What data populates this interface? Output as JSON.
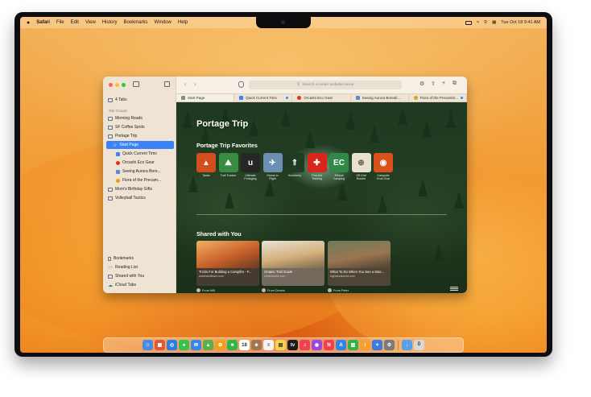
{
  "menubar": {
    "app": "Safari",
    "menus": [
      "File",
      "Edit",
      "View",
      "History",
      "Bookmarks",
      "Window",
      "Help"
    ],
    "clock": "Tue Oct 18  9:41 AM"
  },
  "sidebar": {
    "tabs_label": "4 Tabs",
    "tab_groups_header": "Tab Groups",
    "groups": [
      {
        "label": "Morning Reads"
      },
      {
        "label": "SF Coffee Spots"
      },
      {
        "label": "Portage Trip"
      }
    ],
    "portage_children": [
      {
        "label": "Start Page",
        "selected": true
      },
      {
        "label": "Quick Current Tims"
      },
      {
        "label": "Orcashi Eco Gear"
      },
      {
        "label": "Seeing Aurora Bore..."
      },
      {
        "label": "Flora of the Precam..."
      }
    ],
    "more_groups": [
      {
        "label": "Mom's Birthday Gifts"
      },
      {
        "label": "Volleyball Tactics"
      }
    ],
    "bottom": [
      {
        "label": "Bookmarks"
      },
      {
        "label": "Reading List"
      },
      {
        "label": "Shared with You"
      },
      {
        "label": "iCloud Tabs"
      }
    ]
  },
  "toolbar": {
    "search_placeholder": "Search or enter website name"
  },
  "tabs": [
    {
      "label": "Start Page",
      "color": "#8a8a8a"
    },
    {
      "label": "Quick Current Tims",
      "color": "#3b82f6"
    },
    {
      "label": "Orcashi Eco Gear",
      "color": "#d9381e"
    },
    {
      "label": "Seeing Aurora Boreali...",
      "color": "#5a8ad6"
    },
    {
      "label": "Flora of the Precambr...",
      "color": "#e0a020"
    }
  ],
  "page": {
    "title": "Portage Trip",
    "favorites_title": "Portage Trip Favorites",
    "favorites": [
      {
        "label": "Tanke",
        "glyph": "▲",
        "color": "#d24e1f"
      },
      {
        "label": "Trail Tracker",
        "glyph": "⛰",
        "color": "#3a8c45"
      },
      {
        "label": "Ultimate Portaging",
        "glyph": "u",
        "color": "#262626"
      },
      {
        "label": "Geese in Flight",
        "glyph": "✈",
        "color": "#6a8fb0"
      },
      {
        "label": "Huckberry",
        "glyph": "⇑",
        "color": "#1f3b22"
      },
      {
        "label": "First Aid Training",
        "glyph": "✚",
        "color": "#d9261c"
      },
      {
        "label": "Ethical Camping",
        "glyph": "EC",
        "color": "#2f8a4a"
      },
      {
        "label": "Off Grid Routes",
        "glyph": "⊕",
        "color": "#e8e1cf"
      },
      {
        "label": "Campsite Grub Club",
        "glyph": "◉",
        "color": "#d9521c"
      }
    ],
    "shared_title": "Shared with You",
    "shared": [
      {
        "title": "Tricks For Building a Campfire - F...",
        "source": "watchandlearn.com",
        "from": "From Will",
        "color": "#d8874a"
      },
      {
        "title": "Ontario Trail Guide",
        "source": "ontariotrails.com",
        "from": "From Dennis",
        "color": "#c9bfae"
      },
      {
        "title": "What To Do When You See a Moo...",
        "source": "sightandsound.com",
        "from": "From Peter",
        "color": "#9a7652"
      }
    ]
  },
  "dock": {
    "icons": [
      {
        "name": "finder-icon",
        "color": "#4a8be6",
        "glyph": "☺"
      },
      {
        "name": "launchpad-icon",
        "color": "#e05a3a",
        "glyph": "▦"
      },
      {
        "name": "safari-icon",
        "color": "#2e7de0",
        "glyph": "◎"
      },
      {
        "name": "messages-icon",
        "color": "#38c24a",
        "glyph": "●"
      },
      {
        "name": "mail-icon",
        "color": "#3a86e8",
        "glyph": "✉"
      },
      {
        "name": "maps-icon",
        "color": "#5ab04f",
        "glyph": "▲"
      },
      {
        "name": "photos-icon",
        "color": "#f0a020",
        "glyph": "✿"
      },
      {
        "name": "facetime-icon",
        "color": "#2fb84a",
        "glyph": "■"
      },
      {
        "name": "calendar-icon",
        "color": "#ffffff",
        "glyph": "18"
      },
      {
        "name": "contacts-icon",
        "color": "#a07850",
        "glyph": "☻"
      },
      {
        "name": "reminders-icon",
        "color": "#f4f4f4",
        "glyph": "≡"
      },
      {
        "name": "notes-icon",
        "color": "#f6d34a",
        "glyph": "▤"
      },
      {
        "name": "tv-icon",
        "color": "#1c1c1c",
        "glyph": "tv"
      },
      {
        "name": "music-icon",
        "color": "#f0424e",
        "glyph": "♫"
      },
      {
        "name": "podcasts-icon",
        "color": "#9a4ad8",
        "glyph": "◉"
      },
      {
        "name": "news-icon",
        "color": "#f0424e",
        "glyph": "N"
      },
      {
        "name": "appstore-icon",
        "color": "#2f86e6",
        "glyph": "A"
      },
      {
        "name": "numbers-icon",
        "color": "#30b24a",
        "glyph": "▥"
      },
      {
        "name": "pages-icon",
        "color": "#f3a030",
        "glyph": "/"
      },
      {
        "name": "xcode-icon",
        "color": "#3a7ae0",
        "glyph": "✧"
      },
      {
        "name": "settings-icon",
        "color": "#7a7a7a",
        "glyph": "⚙"
      }
    ],
    "folders": [
      {
        "name": "downloads-folder-icon",
        "color": "#5aa0e8",
        "glyph": "↓"
      },
      {
        "name": "trash-icon",
        "color": "#d8d8d8",
        "glyph": "⌷"
      }
    ]
  }
}
